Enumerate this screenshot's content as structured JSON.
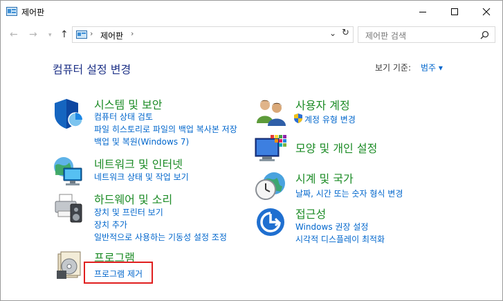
{
  "window": {
    "title": "제어판"
  },
  "address": {
    "path": "제어판",
    "search_placeholder": "제어판 검색"
  },
  "header": {
    "title": "컴퓨터 설정 변경",
    "viewby_label": "보기 기준:",
    "viewby_value": "범주 ▾"
  },
  "categories": {
    "system": {
      "title": "시스템 및 보안",
      "links": [
        "컴퓨터 상태 검토",
        "파일 히스토리로 파일의 백업 복사본 저장",
        "백업 및 복원(Windows 7)"
      ]
    },
    "network": {
      "title": "네트워크 및 인터넷",
      "links": [
        "네트워크 상태 및 작업 보기"
      ]
    },
    "hardware": {
      "title": "하드웨어 및 소리",
      "links": [
        "장치 및 프린터 보기",
        "장치 추가",
        "일반적으로 사용하는 기동성 설정 조정"
      ]
    },
    "programs": {
      "title": "프로그램",
      "links": [
        "프로그램 제거"
      ]
    },
    "users": {
      "title": "사용자 계정",
      "links": [
        "계정 유형 변경"
      ]
    },
    "appearance": {
      "title": "모양 및 개인 설정",
      "links": []
    },
    "clock": {
      "title": "시계 및 국가",
      "links": [
        "날짜, 시간 또는 숫자 형식 변경"
      ]
    },
    "access": {
      "title": "접근성",
      "links": [
        "Windows 권장 설정",
        "시각적 디스플레이 최적화"
      ]
    }
  },
  "colors": {
    "category_title": "#1b8b25",
    "link": "#0066cc",
    "header": "#1e3287",
    "highlight": "#e01e1e"
  }
}
